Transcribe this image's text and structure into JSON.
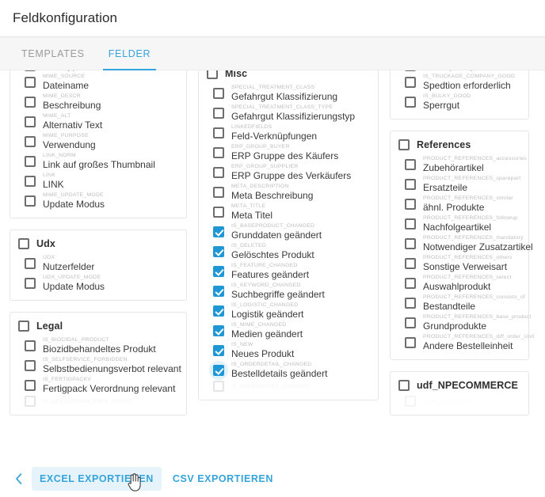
{
  "header": {
    "title": "Feldkonfiguration"
  },
  "tabs": [
    {
      "label": "TEMPLATES",
      "active": false
    },
    {
      "label": "FELDER",
      "active": true
    }
  ],
  "colors": {
    "accent": "#35a4dc",
    "checkbox_checked": "#1f97d4",
    "tabbar_bg": "#f6f6f6",
    "card_border": "#e6e6e6"
  },
  "columns": {
    "left": {
      "cards": [
        {
          "name": "mime-card",
          "clipped_top": true,
          "group": null,
          "rows": [
            {
              "code": "",
              "label": "Dateityp",
              "checked": false,
              "clipped": true
            },
            {
              "code": "MIME_SOURCE",
              "label": "Dateiname",
              "checked": false
            },
            {
              "code": "MIME_DESCR",
              "label": "Beschreibung",
              "checked": false
            },
            {
              "code": "MIME_ALT",
              "label": "Alternativ Text",
              "checked": false
            },
            {
              "code": "MIME_PURPOSE",
              "label": "Verwendung",
              "checked": false
            },
            {
              "code": "LINK_NORM",
              "label": "Link auf großes Thumbnail",
              "checked": false
            },
            {
              "code": "LINK",
              "label": "LINK",
              "checked": false
            },
            {
              "code": "MIME_UPDATE_MODE",
              "label": "Update Modus",
              "checked": false
            }
          ]
        },
        {
          "name": "udx-card",
          "clipped_top": false,
          "group": {
            "label": "Udx",
            "checked": false
          },
          "rows": [
            {
              "code": "UDX",
              "label": "Nutzerfelder",
              "checked": false
            },
            {
              "code": "UDX_UPDATE_MODE",
              "label": "Update Modus",
              "checked": false
            }
          ]
        },
        {
          "name": "legal-card",
          "clipped_top": false,
          "group": {
            "label": "Legal",
            "checked": false
          },
          "rows": [
            {
              "code": "IS_BIOCIDAL_PRODUCT",
              "label": "Biozidbehandeltes Produkt",
              "checked": false
            },
            {
              "code": "IS_SELFSERVICE_FORBIDDEN",
              "label": "Selbstbedienungsverbot relevant",
              "checked": false
            },
            {
              "code": "IS_FERTIGPACKV",
              "label": "Fertigpack Verordnung relevant",
              "checked": false
            },
            {
              "code": "IS_OEKODESIGN_EVPG_ENVKG",
              "label": "",
              "checked": false,
              "fade": 1
            }
          ]
        }
      ]
    },
    "middle": {
      "cards": [
        {
          "name": "misc-card",
          "clipped_top": false,
          "group": {
            "label": "Misc",
            "checked": false
          },
          "rows": [
            {
              "code": "SPECIAL_TREATMENT_CLASS",
              "label": "Gefahrgut Klassifizierung",
              "checked": false
            },
            {
              "code": "SPECIAL_TREATMENT_CLASS_TYPE",
              "label": "Gefahrgut Klassifizierungstyp",
              "checked": false
            },
            {
              "code": "LINKEDFIELDS",
              "label": "Feld-Verknüpfungen",
              "checked": false
            },
            {
              "code": "ERP_GROUP_BUYER",
              "label": "ERP Gruppe des Käufers",
              "checked": false
            },
            {
              "code": "ERP_GROUP_SUPPLIER",
              "label": "ERP Gruppe des Verkäufers",
              "checked": false
            },
            {
              "code": "META_DESCRIPTION",
              "label": "Meta Beschreibung",
              "checked": false
            },
            {
              "code": "META_TITLE",
              "label": "Meta Titel",
              "checked": false
            },
            {
              "code": "IS_BASEPRODUCT_CHANGED",
              "label": "Grunddaten geändert",
              "checked": true
            },
            {
              "code": "IS_DELETED",
              "label": "Gelöschtes Produkt",
              "checked": true
            },
            {
              "code": "IS_FEATURE_CHANGED",
              "label": "Features geändert",
              "checked": true
            },
            {
              "code": "IS_KEYWORD_CHANGED",
              "label": "Suchbegriffe geändert",
              "checked": true
            },
            {
              "code": "IS_LOGISTIC_CHANGED",
              "label": "Logistik geändert",
              "checked": true
            },
            {
              "code": "IS_MIME_CHANGED",
              "label": "Medien geändert",
              "checked": true
            },
            {
              "code": "IS_NEW",
              "label": "Neues Produkt",
              "checked": true
            },
            {
              "code": "IS_ORDERDETAIL_CHANGED",
              "label": "Bestelldetails geändert",
              "checked": true,
              "focused": true
            },
            {
              "code": "IS_REFERENCES_CHANGED",
              "label": "",
              "checked": false,
              "fade": 1
            }
          ]
        }
      ]
    },
    "right": {
      "cards": [
        {
          "name": "logistics-card",
          "clipped_top": true,
          "group": null,
          "rows": [
            {
              "code": "",
              "label": "Grundpreispflicht",
              "checked": false,
              "clipped": true
            },
            {
              "code": "IS_TRUCKAGE_COMPANY_GOOD",
              "label": "Spedtion erforderlich",
              "checked": false
            },
            {
              "code": "IS_BULKY_GOOD",
              "label": "Sperrgut",
              "checked": false
            }
          ]
        },
        {
          "name": "references-card",
          "clipped_top": false,
          "group": {
            "label": "References",
            "checked": false
          },
          "rows": [
            {
              "code": "PRODUCT_REFERENCES_accessories",
              "label": "Zubehörartikel",
              "checked": false,
              "lowercase_code": true
            },
            {
              "code": "PRODUCT_REFERENCES_sparepart",
              "label": "Ersatzteile",
              "checked": false,
              "lowercase_code": true
            },
            {
              "code": "PRODUCT_REFERENCES_similar",
              "label": "ähnl. Produkte",
              "checked": false,
              "lowercase_code": true
            },
            {
              "code": "PRODUCT_REFERENCES_followup",
              "label": "Nachfolgeartikel",
              "checked": false,
              "lowercase_code": true
            },
            {
              "code": "PRODUCT_REFERENCES_mandatory",
              "label": "Notwendiger Zusatzartikel",
              "checked": false,
              "lowercase_code": true
            },
            {
              "code": "PRODUCT_REFERENCES_others",
              "label": "Sonstige Verweisart",
              "checked": false,
              "lowercase_code": true
            },
            {
              "code": "PRODUCT_REFERENCES_select",
              "label": "Auswahlprodukt",
              "checked": false,
              "lowercase_code": true
            },
            {
              "code": "PRODUCT_REFERENCES_consists_of",
              "label": "Bestandteile",
              "checked": false,
              "lowercase_code": true
            },
            {
              "code": "PRODUCT_REFERENCES_base_product",
              "label": "Grundprodukte",
              "checked": false,
              "lowercase_code": true
            },
            {
              "code": "PRODUCT_REFERENCES_diff_order_Unit",
              "label": "Andere Bestelleinheit",
              "checked": false,
              "lowercase_code": true
            }
          ]
        },
        {
          "name": "udf-npecommerce-card",
          "clipped_top": false,
          "group": {
            "label": "udf_NPECOMMERCE",
            "checked": false
          },
          "rows": [
            {
              "code": "EBAY_CATEGORY",
              "label": "",
              "checked": false,
              "fade": 2
            }
          ]
        }
      ]
    }
  },
  "footer": {
    "back_icon": "chevron-left-icon",
    "excel_label": "EXCEL EXPORTIEREN",
    "csv_label": "CSV EXPORTIEREN"
  }
}
